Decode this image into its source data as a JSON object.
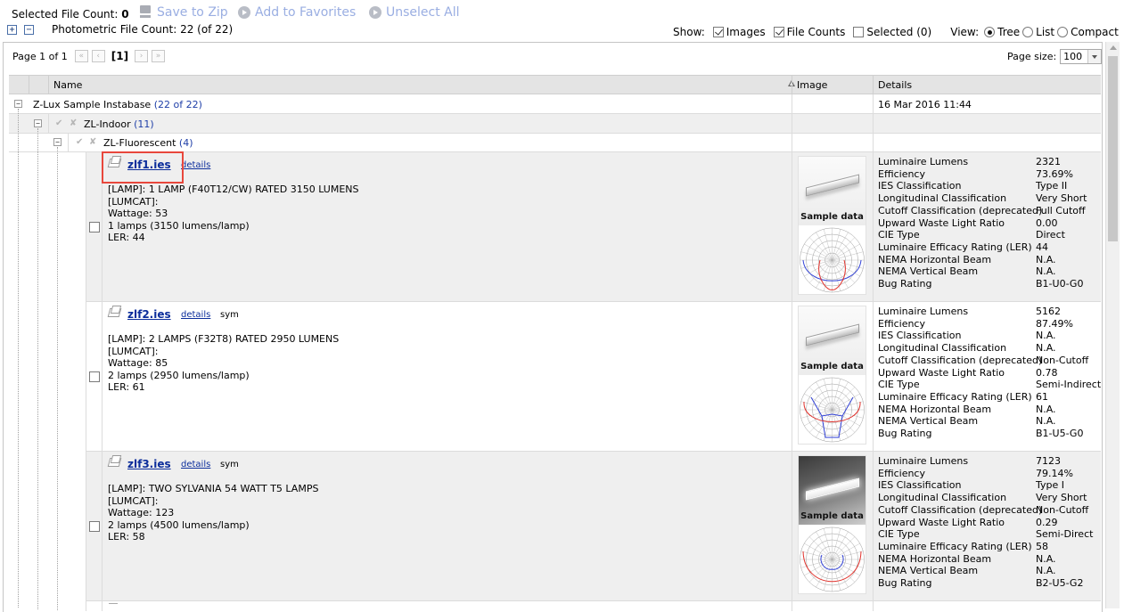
{
  "toolbar": {
    "selected_label": "Selected File Count:",
    "selected_count": "0",
    "save_zip": "Save to Zip",
    "add_favorites": "Add to Favorites",
    "unselect_all": "Unselect All",
    "expand_symbol": "+",
    "collapse_symbol": "−",
    "photometric_count": "Photometric File Count: 22 (of 22)"
  },
  "show_bar": {
    "show_label": "Show:",
    "images": "Images",
    "file_counts": "File Counts",
    "selected": "Selected (0)",
    "view_label": "View:",
    "tree": "Tree",
    "list": "List",
    "compact": "Compact"
  },
  "pager": {
    "page_info": "Page 1 of 1",
    "first": "«",
    "prev": "‹",
    "current": "[1]",
    "next": "›",
    "last": "»",
    "page_size_label": "Page size:",
    "page_size_value": "100"
  },
  "columns": {
    "name": "Name",
    "image": "Image",
    "details": "Details"
  },
  "tree": {
    "root": {
      "label": "Z-Lux Sample Instabase",
      "count": "(22 of 22)",
      "date": "16 Mar 2016 11:44"
    },
    "level1": {
      "label": "ZL-Indoor",
      "count": "(11)"
    },
    "level2": {
      "label": "ZL-Fluorescent",
      "count": "(4)"
    }
  },
  "files": [
    {
      "name": "zlf1.ies",
      "details_link": "details",
      "sym": "",
      "desc": "[LAMP]: 1 LAMP (F40T12/CW) RATED 3150 LUMENS\n[LUMCAT]:\nWattage: 53\n1 lamps (3150 lumens/lamp)\nLER: 44",
      "sample_label": "Sample data",
      "details": [
        [
          "Luminaire Lumens",
          "2321"
        ],
        [
          "Efficiency",
          "73.69%"
        ],
        [
          "IES Classification",
          "Type II"
        ],
        [
          "Longitudinal Classification",
          "Very Short"
        ],
        [
          "Cutoff Classification (deprecated)",
          "Full Cutoff"
        ],
        [
          "Upward Waste Light Ratio",
          "0.00"
        ],
        [
          "CIE Type",
          "Direct"
        ],
        [
          "Luminaire Efficacy Rating (LER)",
          "44"
        ],
        [
          "NEMA Horizontal Beam",
          "N.A."
        ],
        [
          "NEMA Vertical Beam",
          "N.A."
        ],
        [
          "Bug Rating",
          "B1-U0-G0"
        ]
      ]
    },
    {
      "name": "zlf2.ies",
      "details_link": "details",
      "sym": "sym",
      "desc": "[LAMP]: 2 LAMPS (F32T8) RATED 2950 LUMENS\n[LUMCAT]:\nWattage: 85\n2 lamps (2950 lumens/lamp)\nLER: 61",
      "sample_label": "Sample data",
      "details": [
        [
          "Luminaire Lumens",
          "5162"
        ],
        [
          "Efficiency",
          "87.49%"
        ],
        [
          "IES Classification",
          "N.A."
        ],
        [
          "Longitudinal Classification",
          "N.A."
        ],
        [
          "Cutoff Classification (deprecated)",
          "Non-Cutoff"
        ],
        [
          "Upward Waste Light Ratio",
          "0.78"
        ],
        [
          "CIE Type",
          "Semi-Indirect"
        ],
        [
          "Luminaire Efficacy Rating (LER)",
          "61"
        ],
        [
          "NEMA Horizontal Beam",
          "N.A."
        ],
        [
          "NEMA Vertical Beam",
          "N.A."
        ],
        [
          "Bug Rating",
          "B1-U5-G0"
        ]
      ]
    },
    {
      "name": "zlf3.ies",
      "details_link": "details",
      "sym": "sym",
      "desc": "[LAMP]: TWO SYLVANIA 54 WATT T5 LAMPS\n[LUMCAT]:\nWattage: 123\n2 lamps (4500 lumens/lamp)\nLER: 58",
      "sample_label": "Sample data",
      "details": [
        [
          "Luminaire Lumens",
          "7123"
        ],
        [
          "Efficiency",
          "79.14%"
        ],
        [
          "IES Classification",
          "Type I"
        ],
        [
          "Longitudinal Classification",
          "Very Short"
        ],
        [
          "Cutoff Classification (deprecated)",
          "Non-Cutoff"
        ],
        [
          "Upward Waste Light Ratio",
          "0.29"
        ],
        [
          "CIE Type",
          "Semi-Direct"
        ],
        [
          "Luminaire Efficacy Rating (LER)",
          "58"
        ],
        [
          "NEMA Horizontal Beam",
          "N.A."
        ],
        [
          "NEMA Vertical Beam",
          "N.A."
        ],
        [
          "Bug Rating",
          "B2-U5-G2"
        ]
      ]
    }
  ]
}
